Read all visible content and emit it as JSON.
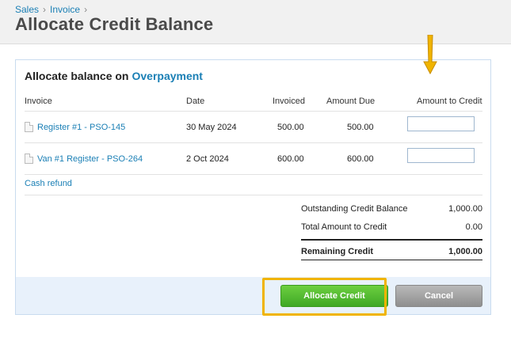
{
  "breadcrumb": {
    "item1": "Sales",
    "item2": "Invoice",
    "sep": "›"
  },
  "page": {
    "title": "Allocate Credit Balance"
  },
  "panel": {
    "title_prefix": "Allocate balance on",
    "title_accent": "Overpayment",
    "columns": {
      "invoice": "Invoice",
      "date": "Date",
      "invoiced": "Invoiced",
      "amount_due": "Amount Due",
      "amount_to_credit": "Amount to Credit"
    },
    "rows": [
      {
        "invoice": "Register #1 - PSO-145",
        "date": "30 May 2024",
        "invoiced": "500.00",
        "amount_due": "500.00",
        "credit_value": ""
      },
      {
        "invoice": "Van #1 Register - PSO-264",
        "date": "2 Oct 2024",
        "invoiced": "600.00",
        "amount_due": "600.00",
        "credit_value": ""
      }
    ],
    "cash_refund": "Cash refund",
    "summary": {
      "outstanding_label": "Outstanding Credit Balance",
      "outstanding_value": "1,000.00",
      "total_label": "Total Amount to Credit",
      "total_value": "0.00",
      "remaining_label": "Remaining Credit",
      "remaining_value": "1,000.00"
    }
  },
  "buttons": {
    "allocate": "Allocate Credit",
    "cancel": "Cancel"
  },
  "colors": {
    "accent": "#1a7fb5",
    "allocate_green": "#4cb82e",
    "highlight": "#f0b400"
  },
  "icons": {
    "row_icon": "document-icon",
    "annotation": "arrow-down-icon"
  }
}
